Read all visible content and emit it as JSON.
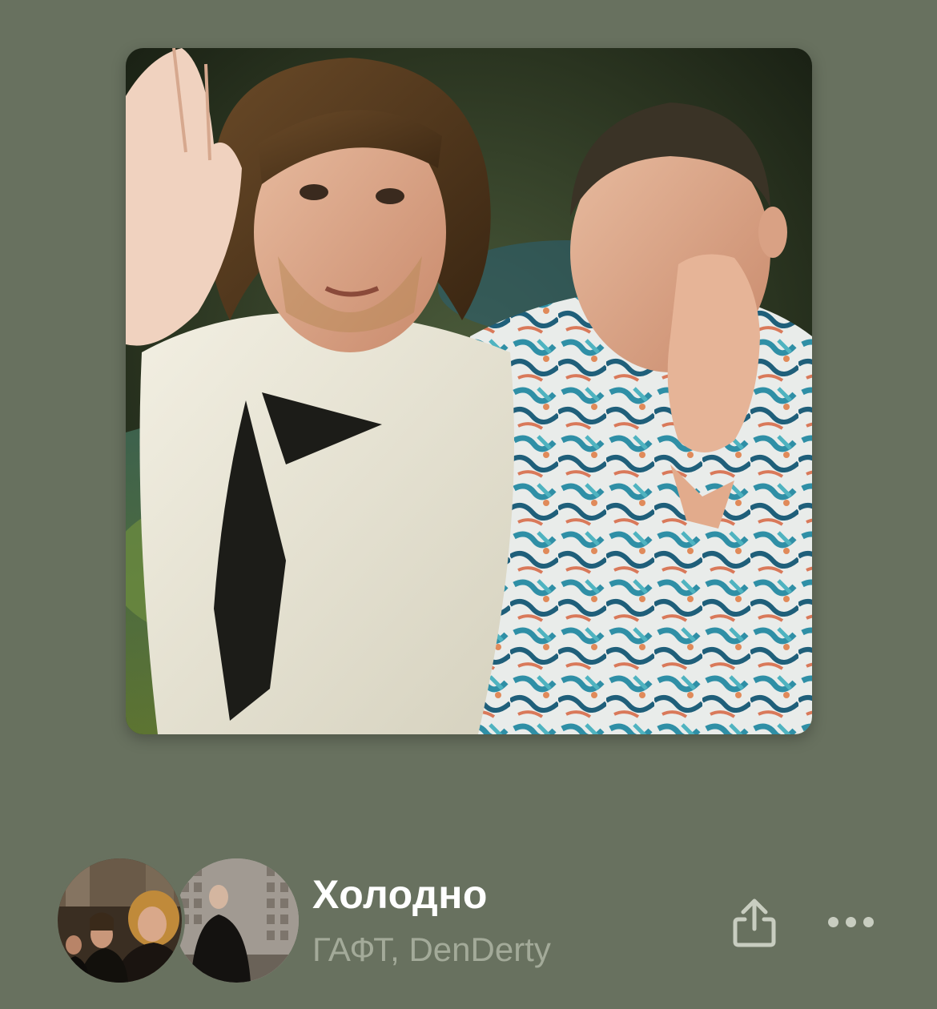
{
  "track": {
    "title": "Холодно",
    "artists": "ГАФТ, DenDerty"
  },
  "artists": [
    {
      "name": "ГАФТ"
    },
    {
      "name": "DenDerty"
    }
  ],
  "icons": {
    "share": "share-icon",
    "more": "more-icon"
  },
  "colors": {
    "background": "#68715f",
    "title": "#ffffff",
    "subtitle": "#a3aa99",
    "icon": "#c8cdc0"
  }
}
